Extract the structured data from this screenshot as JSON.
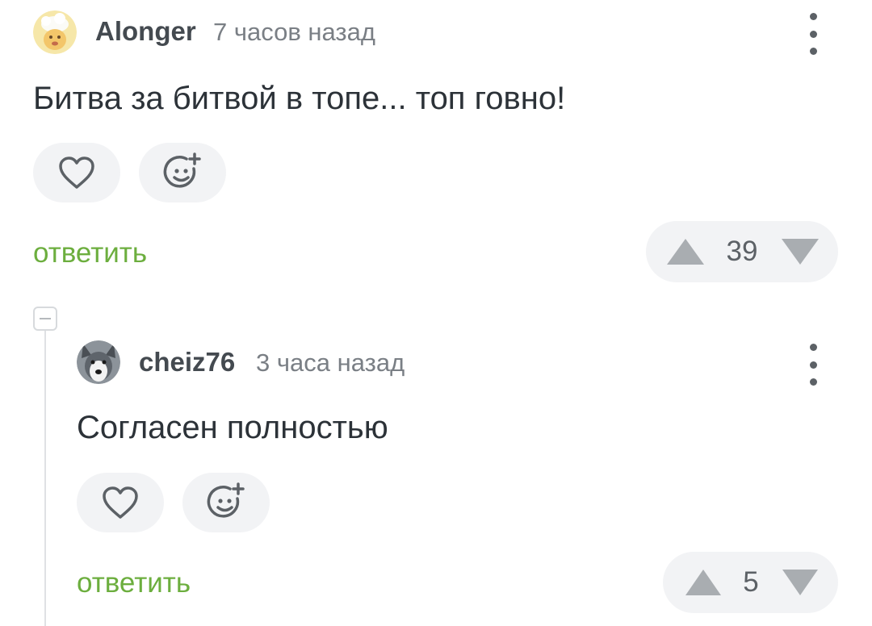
{
  "comments": [
    {
      "username": "Alonger",
      "timestamp": "7 часов назад",
      "text": "Битва за битвой в топе... топ говно!",
      "reply_label": "ответить",
      "rating": "39",
      "avatar_icon": "cartoon-avatar-icon"
    },
    {
      "username": "cheiz76",
      "timestamp": "3 часа назад",
      "text": "Согласен полностью",
      "reply_label": "ответить",
      "rating": "5",
      "avatar_icon": "husky-avatar-icon"
    }
  ],
  "colors": {
    "accent_green": "#6cae3e",
    "button_bg": "#f2f3f5",
    "icon_gray": "#5c6166",
    "vote_gray": "#a9adb1"
  }
}
